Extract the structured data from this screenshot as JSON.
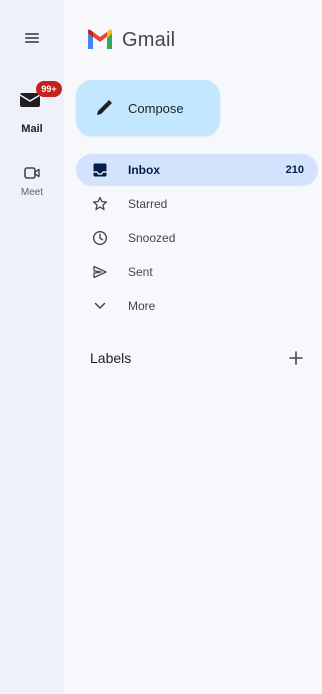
{
  "app": {
    "title": "Gmail"
  },
  "rail": {
    "menu_icon": "hamburger-menu-icon",
    "items": [
      {
        "label": "Mail",
        "icon": "mail-icon",
        "badge": "99+"
      },
      {
        "label": "Meet",
        "icon": "video-camera-icon"
      }
    ]
  },
  "compose": {
    "label": "Compose",
    "icon": "pencil-icon"
  },
  "nav": {
    "items": [
      {
        "label": "Inbox",
        "icon": "inbox-icon",
        "count": "210",
        "active": true
      },
      {
        "label": "Starred",
        "icon": "star-icon"
      },
      {
        "label": "Snoozed",
        "icon": "clock-icon"
      },
      {
        "label": "Sent",
        "icon": "send-icon"
      },
      {
        "label": "More",
        "icon": "chevron-down-icon"
      }
    ]
  },
  "labels": {
    "title": "Labels",
    "add_icon": "plus-icon"
  },
  "colors": {
    "background": "#f6f8fc",
    "rail": "#eef1f9",
    "compose": "#c2e7ff",
    "active_item": "#d3e3fd",
    "badge": "#c5221f"
  }
}
